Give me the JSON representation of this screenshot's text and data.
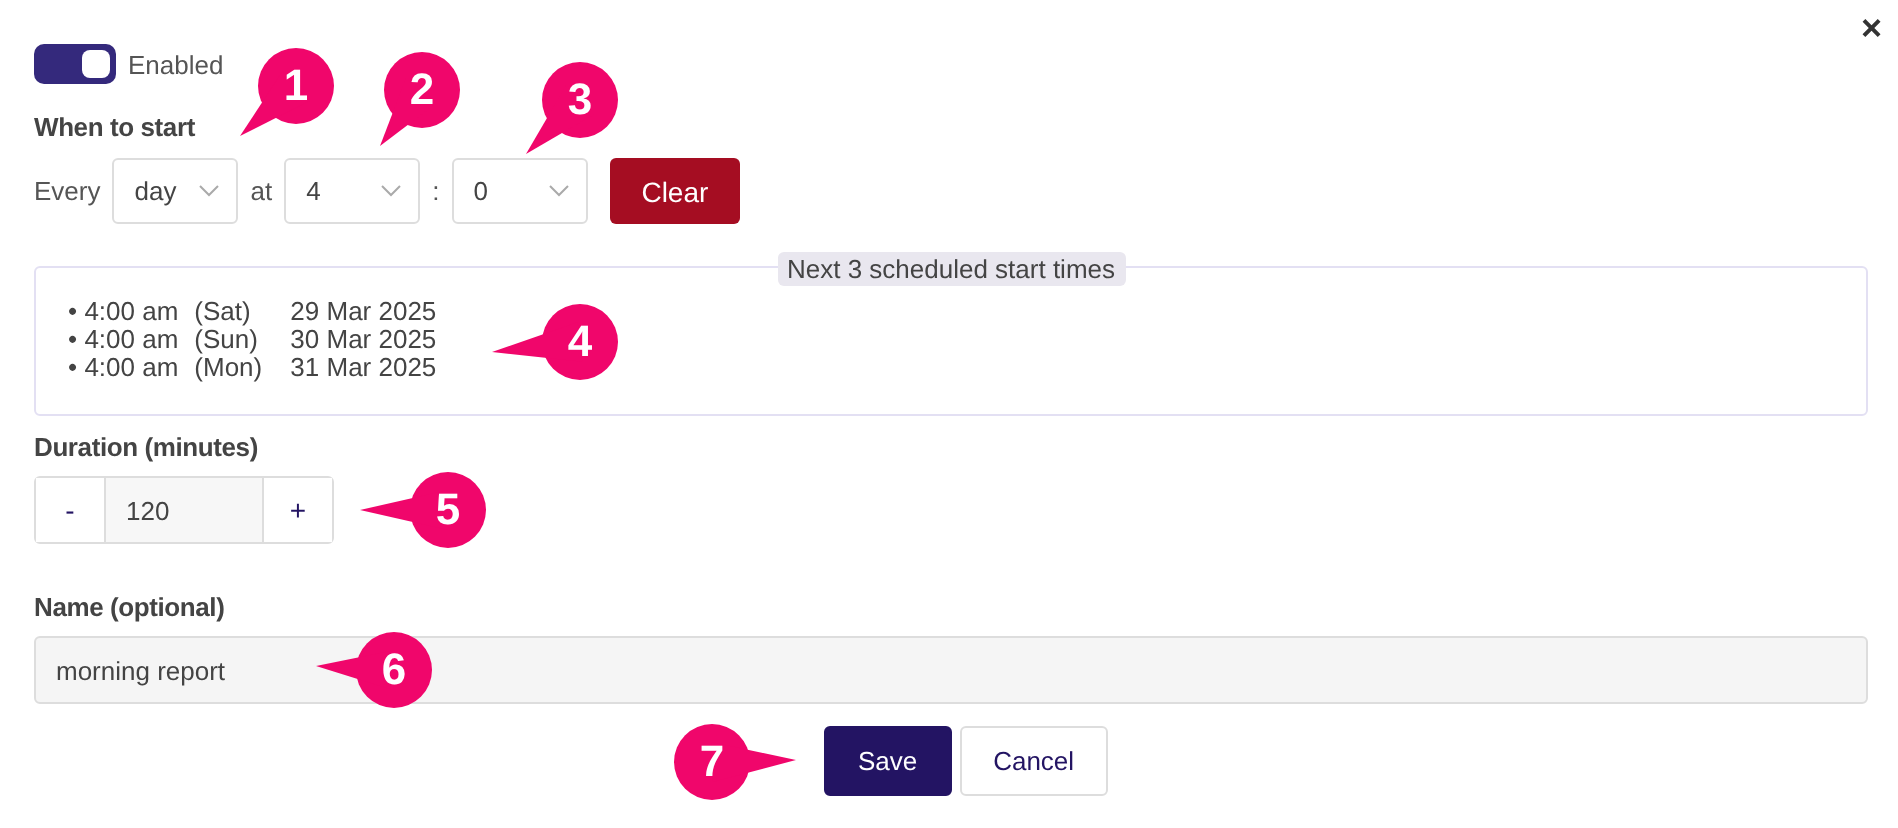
{
  "close_button": "×",
  "toggle": {
    "label": "Enabled",
    "on": true
  },
  "when_to_start": {
    "label": "When to start",
    "every_label": "Every",
    "unit": "day",
    "at_label": "at",
    "hour": "4",
    "separator": ":",
    "minute": "0",
    "clear_button": "Clear"
  },
  "schedule_preview": {
    "legend": "Next 3 scheduled start times",
    "items": [
      {
        "bullet": "•",
        "time": "4:00 am",
        "weekday": "(Sat)",
        "date": "29 Mar 2025"
      },
      {
        "bullet": "•",
        "time": "4:00 am",
        "weekday": "(Sun)",
        "date": "30 Mar 2025"
      },
      {
        "bullet": "•",
        "time": "4:00 am",
        "weekday": "(Mon)",
        "date": "31 Mar 2025"
      }
    ]
  },
  "duration": {
    "label": "Duration (minutes)",
    "minus": "-",
    "value": "120",
    "plus": "+"
  },
  "name": {
    "label": "Name (optional)",
    "value": "morning report"
  },
  "buttons": [
    {
      "label": "Save",
      "kind": "primary"
    },
    {
      "label": "Cancel",
      "kind": "secondary"
    }
  ],
  "callouts": [
    {
      "number": "1"
    },
    {
      "number": "2"
    },
    {
      "number": "3"
    },
    {
      "number": "4"
    },
    {
      "number": "5"
    },
    {
      "number": "6"
    },
    {
      "number": "7"
    }
  ]
}
